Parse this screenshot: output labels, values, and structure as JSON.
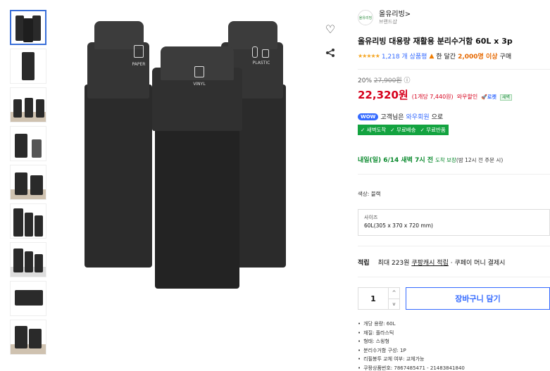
{
  "brand": {
    "name": "올유리빙>",
    "sub": "브랜드샵",
    "logo_text": "올유리빙"
  },
  "product": {
    "title": "올유리빙 대용량 재활용 분리수거함 60L x 3p",
    "stars": "★★★★★",
    "review_count": "1,218 개 상품평",
    "purchase_note_prefix": "한 달간",
    "purchase_count": "2,000명 이상",
    "purchase_suffix": "구매"
  },
  "pricing": {
    "discount": "20%",
    "original": "27,900원",
    "info_icon": "ⓘ",
    "price": "22,320원",
    "unit_price": "(1개당 7,440원)",
    "wow_discount": "와우할인",
    "rocket_label": "로켓",
    "rocket_badge": "새벽"
  },
  "wow": {
    "badge": "WOW",
    "text_a": "고객님은",
    "text_b": "와우회원",
    "text_c": "으로"
  },
  "perks": [
    "✓ 새벽도착",
    "✓ 무료배송",
    "✓ 무료반품"
  ],
  "arrival": {
    "date": "내일(일) 6/14 새벽 7시 전",
    "guarantee": "도착 보장",
    "note": "(밤 12시 전 주문 시)"
  },
  "options": {
    "color_label": "색상: 블랙",
    "size_label": "사이즈",
    "size_value": "60L(305 x 370 x 720 mm)"
  },
  "earn": {
    "label": "적립",
    "prefix": "최대 223원",
    "link": "쿠팡캐시 적립",
    "suffix": "· 쿠페이 머니 결제시"
  },
  "cart": {
    "qty": "1",
    "up": "^",
    "down": "v",
    "button": "장바구니 담기"
  },
  "specs": [
    "개당 용량: 60L",
    "재질: 플라스틱",
    "형태: 스윙형",
    "분리수거함 구성: 1P",
    "리필봉투 교체 여부: 교체가능",
    "쿠팡상품번호: 7867485471 - 21483841840"
  ],
  "image_labels": {
    "paper": "PAPER",
    "plastic": "PLASTIC",
    "vinyl": "VINYL"
  },
  "icons": {
    "heart": "heart-icon",
    "share": "share-icon"
  }
}
